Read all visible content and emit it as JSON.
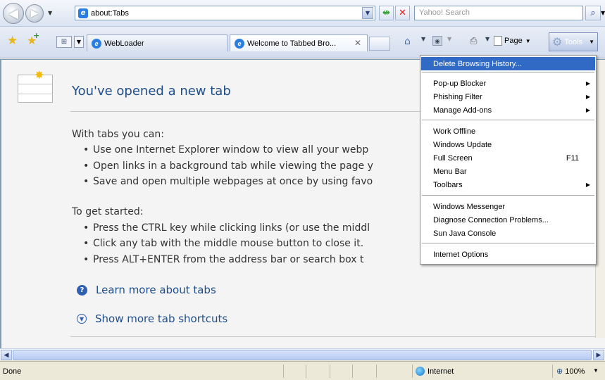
{
  "address_bar": {
    "url": "about:Tabs",
    "search_placeholder": "Yahoo! Search"
  },
  "tabs": [
    {
      "label": "WebLoader"
    },
    {
      "label": "Welcome to Tabbed Bro..."
    }
  ],
  "command_bar": {
    "page_label": "Page",
    "tools_label": "Tools"
  },
  "content": {
    "title": "You've opened a new tab",
    "with_tabs_heading": "With tabs you can:",
    "with_tabs_items": [
      "Use one Internet Explorer window to view all your webp",
      "Open links in a background tab while viewing the page y",
      "Save and open multiple webpages at once by using favo"
    ],
    "get_started_heading": "To get started:",
    "get_started_items": [
      "Press the CTRL key while clicking links (or use the middl",
      "Click any tab with the middle mouse button to close it.",
      "Press ALT+ENTER from the address bar or search box t"
    ],
    "learn_more_link": "Learn more about tabs",
    "shortcuts_link": "Show more tab shortcuts"
  },
  "tools_menu": {
    "items": [
      {
        "label": "Delete Browsing History...",
        "highlighted": true
      },
      {
        "label": "Pop-up Blocker",
        "submenu": true
      },
      {
        "label": "Phishing Filter",
        "submenu": true
      },
      {
        "label": "Manage Add-ons",
        "submenu": true
      },
      {
        "label": "Work Offline"
      },
      {
        "label": "Windows Update"
      },
      {
        "label": "Full Screen",
        "accelerator": "F11"
      },
      {
        "label": "Menu Bar"
      },
      {
        "label": "Toolbars",
        "submenu": true
      },
      {
        "label": "Windows Messenger"
      },
      {
        "label": "Diagnose Connection Problems..."
      },
      {
        "label": "Sun Java Console"
      },
      {
        "label": "Internet Options"
      }
    ]
  },
  "status_bar": {
    "status": "Done",
    "zone": "Internet",
    "zoom": "100%"
  },
  "icons": [
    "back-icon",
    "forward-icon",
    "ie-page-icon",
    "refresh-icon",
    "stop-icon",
    "search-icon",
    "favorites-star-icon",
    "add-favorite-icon",
    "quick-tabs-icon",
    "home-icon",
    "feeds-icon",
    "print-icon",
    "page-icon",
    "gear-icon",
    "new-tab-icon",
    "help-icon",
    "expand-icon",
    "globe-icon",
    "zoom-icon"
  ],
  "colors": {
    "menu_highlight": "#316ac5",
    "link": "#1f4e8a",
    "title": "#1f4e8a"
  }
}
